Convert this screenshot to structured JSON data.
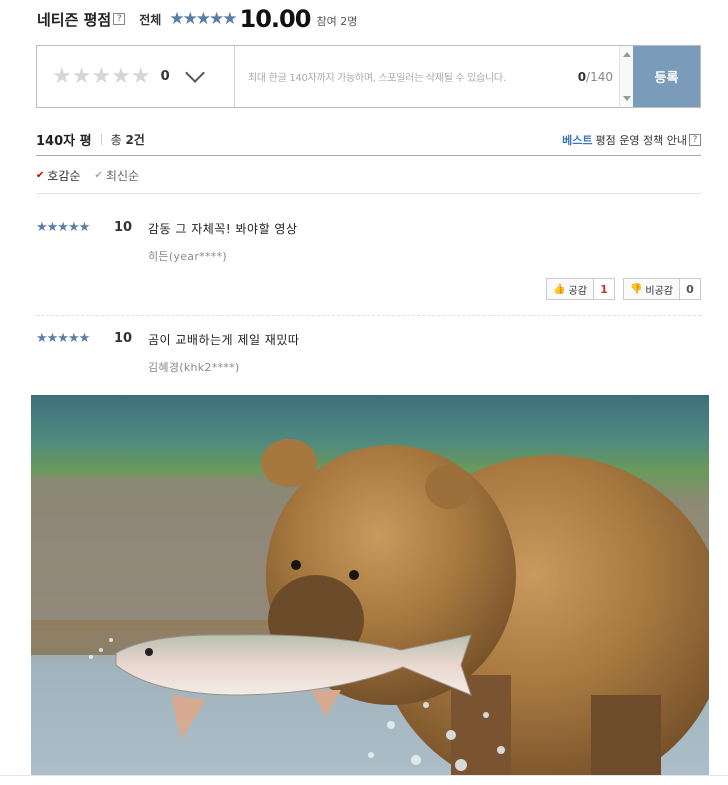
{
  "header": {
    "title": "네티즌 평점",
    "help": "?",
    "overall_label": "전체",
    "stars": "★★★★★",
    "score": "10.00",
    "participants": "참여 2명"
  },
  "input": {
    "empty_stars": "★★★★★",
    "star_score": "0",
    "placeholder": "최대 한글 140자까지 가능하며, 스포일러는 삭제될 수 있습니다.",
    "counter_current": "0",
    "counter_max": "/140",
    "submit_label": "등록"
  },
  "summary": {
    "title": "140자 평",
    "total_prefix": "총 ",
    "total_count": "2건",
    "policy_best": "베스트",
    "policy_text": "평점 운영 정책 안내",
    "policy_help": "?"
  },
  "sort": [
    {
      "label": "호감순",
      "active": true
    },
    {
      "label": "최신순",
      "active": false
    }
  ],
  "reviews": [
    {
      "stars": "★★★★★",
      "score": "10",
      "text": "감동 그 자체꼭! 봐야할 영상",
      "author": "히든(year****)",
      "like_label": "공감",
      "like_count": "1",
      "dislike_label": "비공감",
      "dislike_count": "0"
    },
    {
      "stars": "★★★★★",
      "score": "10",
      "text": "곰이 교배하는게 제일 재밌따",
      "author": "김혜경(khk2****)"
    }
  ],
  "colors": {
    "accent": "#5a7ea8",
    "submit": "#7a9bb9",
    "best": "#3a78b5"
  },
  "image": {
    "subject": "brown bear catching a salmon in a river"
  }
}
